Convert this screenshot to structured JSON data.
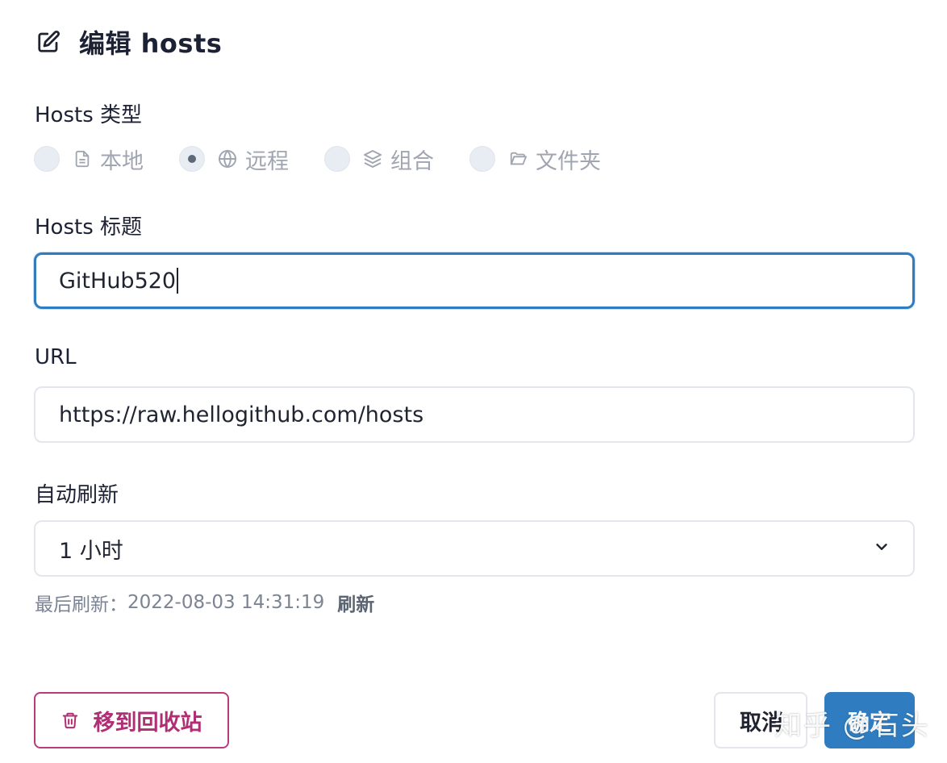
{
  "header": {
    "title": "编辑 hosts"
  },
  "hosts_type": {
    "label": "Hosts 类型",
    "options": [
      {
        "label": "本地",
        "icon": "document-icon",
        "selected": false
      },
      {
        "label": "远程",
        "icon": "globe-icon",
        "selected": true
      },
      {
        "label": "组合",
        "icon": "layers-icon",
        "selected": false
      },
      {
        "label": "文件夹",
        "icon": "folder-icon",
        "selected": false
      }
    ]
  },
  "hosts_title": {
    "label": "Hosts 标题",
    "value": "GitHub520"
  },
  "url": {
    "label": "URL",
    "value": "https://raw.hellogithub.com/hosts"
  },
  "auto_refresh": {
    "label": "自动刷新",
    "selected": "1 小时",
    "last_refresh_label": "最后刷新：",
    "last_refresh_time": "2022-08-03 14:31:19",
    "refresh_link": "刷新"
  },
  "footer": {
    "trash_label": "移到回收站",
    "cancel_label": "取消",
    "ok_label": "确定"
  },
  "watermark": "知乎 @石头",
  "colors": {
    "accent": "#2f7dc0",
    "danger": "#b02e73",
    "muted": "#a0a6b1"
  }
}
